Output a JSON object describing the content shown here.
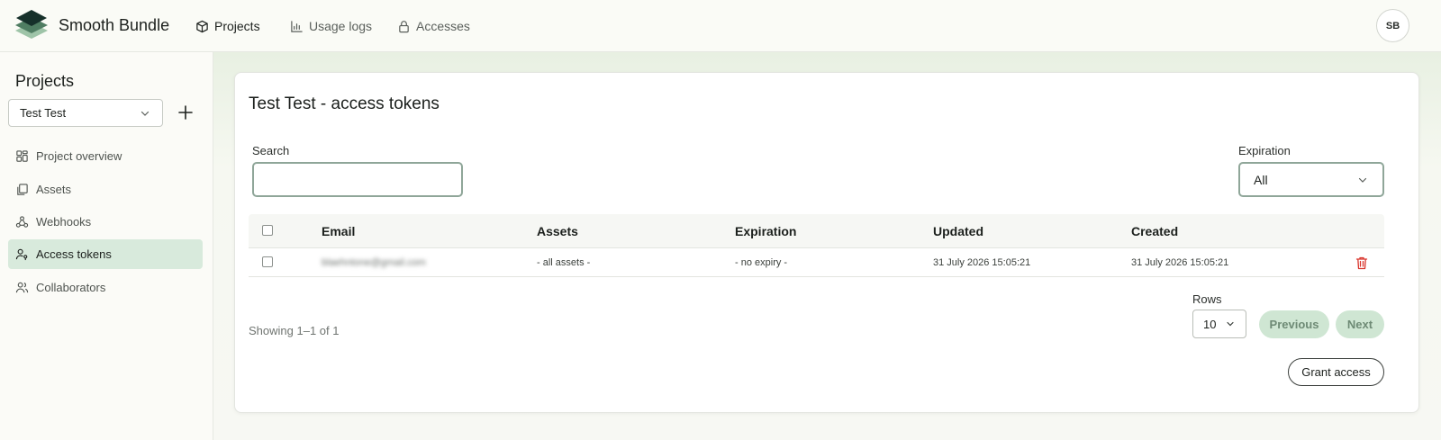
{
  "app": {
    "brand": "Smooth Bundle",
    "avatar_initials": "SB"
  },
  "topnav": {
    "items": [
      {
        "label": "Projects",
        "icon": "box-icon",
        "active": true
      },
      {
        "label": "Usage logs",
        "icon": "bar-chart-icon"
      },
      {
        "label": "Accesses",
        "icon": "lock-icon"
      }
    ]
  },
  "sidebar": {
    "title": "Projects",
    "selected_project": "Test Test",
    "items": [
      {
        "label": "Project overview",
        "icon": "dashboard-icon"
      },
      {
        "label": "Assets",
        "icon": "copy-icon"
      },
      {
        "label": "Webhooks",
        "icon": "webhook-icon"
      },
      {
        "label": "Access tokens",
        "icon": "user-key-icon",
        "active": true
      },
      {
        "label": "Collaborators",
        "icon": "users-icon"
      }
    ]
  },
  "main": {
    "title": "Test Test - access tokens",
    "search_label": "Search",
    "search_value": "",
    "expiration_label": "Expiration",
    "expiration_value": "All",
    "table": {
      "columns": [
        "Email",
        "Assets",
        "Expiration",
        "Updated",
        "Created"
      ],
      "rows": [
        {
          "email": "blaehntone@gmail.com",
          "assets": "- all assets -",
          "expiration": "- no expiry -",
          "updated": "31 July 2026 15:05:21",
          "created": "31 July 2026 15:05:21"
        }
      ]
    },
    "showing": "Showing 1–1 of 1",
    "rows_label": "Rows",
    "rows_value": "10",
    "previous_label": "Previous",
    "next_label": "Next",
    "grant_label": "Grant access"
  },
  "colors": {
    "accent": "#d8eadc",
    "pagination_button": "#cfe6d3",
    "danger": "#d9342b",
    "logo_dark": "#16302a",
    "logo_mid": "#4f7d62",
    "logo_light": "#9ec4a8"
  }
}
